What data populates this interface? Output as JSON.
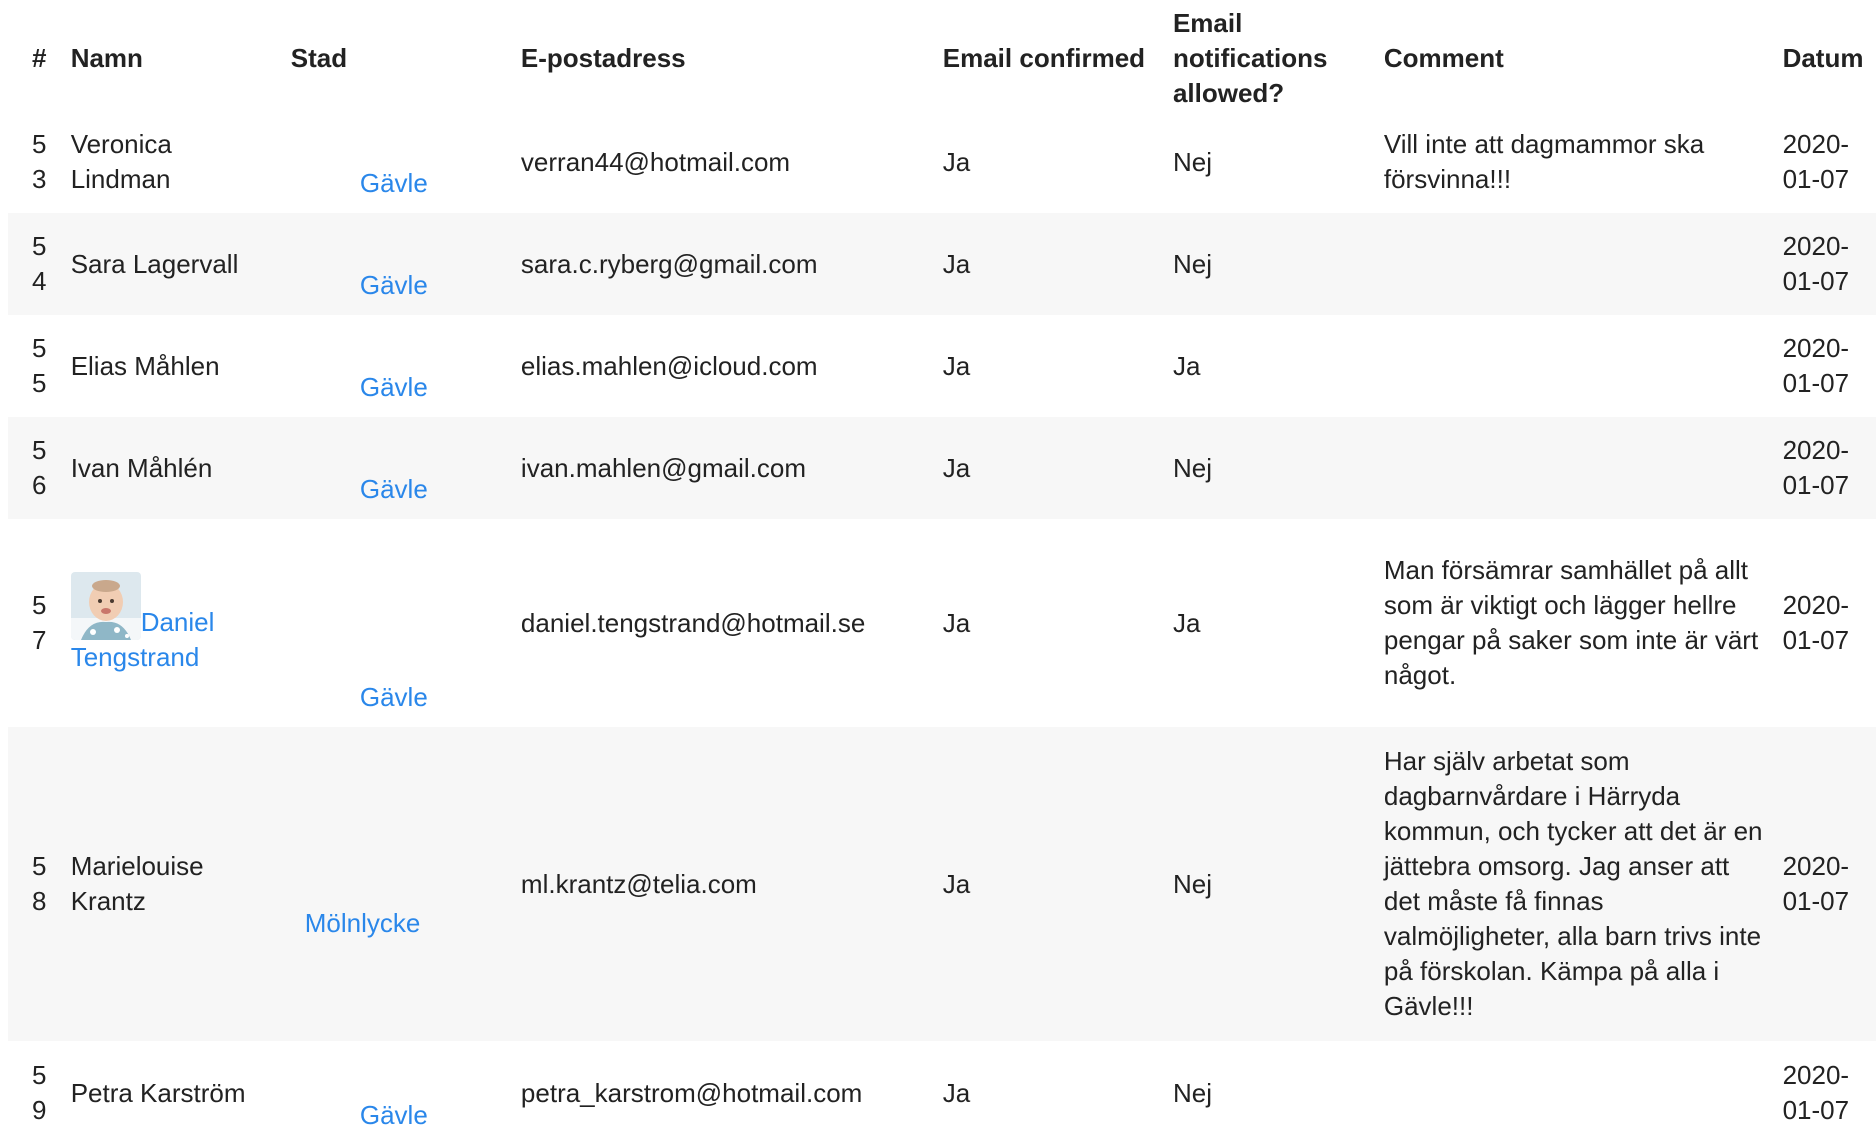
{
  "table": {
    "headers": {
      "num": "#",
      "name": "Namn",
      "city": "Stad",
      "email": "E-postadress",
      "confirmed": "Email confirmed",
      "notifications": "Email notifications allowed?",
      "comment": "Comment",
      "date": "Datum"
    },
    "rows": [
      {
        "num": "53",
        "name": "Veronica Lindman",
        "city": "Gävle",
        "email": "verran44@hotmail.com",
        "confirmed": "Ja",
        "notifications": "Nej",
        "comment": "Vill inte att dagmammor ska försvinna!!!",
        "date": "2020-01-07"
      },
      {
        "num": "54",
        "name": "Sara Lagervall",
        "city": "Gävle",
        "email": "sara.c.ryberg@gmail.com",
        "confirmed": "Ja",
        "notifications": "Nej",
        "comment": "",
        "date": "2020-01-07"
      },
      {
        "num": "55",
        "name": "Elias Måhlen",
        "city": "Gävle",
        "email": "elias.mahlen@icloud.com",
        "confirmed": "Ja",
        "notifications": "Ja",
        "comment": "",
        "date": "2020-01-07"
      },
      {
        "num": "56",
        "name": "Ivan Måhlén",
        "city": "Gävle",
        "email": "ivan.mahlen@gmail.com",
        "confirmed": "Ja",
        "notifications": "Nej",
        "comment": "",
        "date": "2020-01-07"
      },
      {
        "num": "57",
        "name": "Daniel Tengstrand",
        "city": "Gävle",
        "email": "daniel.tengstrand@hotmail.se",
        "confirmed": "Ja",
        "notifications": "Ja",
        "comment": "Man försämrar samhället på allt som är viktigt och lägger hellre pengar på saker som inte är värt något.",
        "date": "2020-01-07"
      },
      {
        "num": "58",
        "name": "Marielouise Krantz",
        "city": "Mölnlycke",
        "email": "ml.krantz@telia.com",
        "confirmed": "Ja",
        "notifications": "Nej",
        "comment": "Har själv arbetat som dagbarnvårdare i Härryda kommun, och tycker att det är en jättebra omsorg. Jag anser att det måste få finnas valmöjligheter, alla barn trivs inte på förskolan. Kämpa på alla i Gävle!!!",
        "date": "2020-01-07"
      },
      {
        "num": "59",
        "name": "Petra Karström",
        "city": "Gävle",
        "email": "petra_karstrom@hotmail.com",
        "confirmed": "Ja",
        "notifications": "Nej",
        "comment": "",
        "date": "2020-01-07"
      }
    ]
  }
}
